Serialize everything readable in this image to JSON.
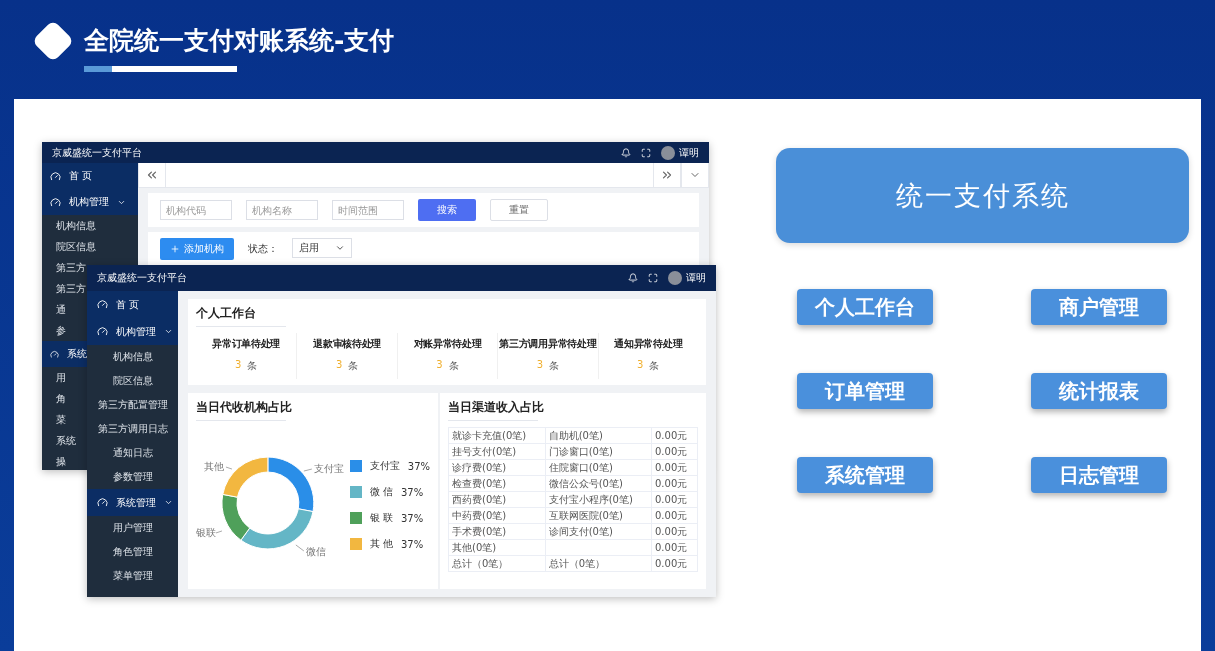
{
  "header": {
    "title": "全院统一支付对账系统-支付"
  },
  "back_window": {
    "app_title": "京威盛统一支付平台",
    "user": "谭明",
    "nav": [
      {
        "label": "首 页",
        "kind": "link"
      },
      {
        "label": "机构管理",
        "kind": "group",
        "expanded": true
      },
      {
        "label": "机构信息",
        "kind": "sub"
      },
      {
        "label": "院区信息",
        "kind": "sub"
      },
      {
        "label": "第三方",
        "kind": "sub"
      },
      {
        "label": "第三方",
        "kind": "sub"
      },
      {
        "label": "通",
        "kind": "sub"
      },
      {
        "label": "参",
        "kind": "sub"
      },
      {
        "label": "系统",
        "kind": "group"
      },
      {
        "label": "用",
        "kind": "sub"
      },
      {
        "label": "角",
        "kind": "sub"
      },
      {
        "label": "菜",
        "kind": "sub"
      },
      {
        "label": "系统",
        "kind": "sub"
      },
      {
        "label": "操",
        "kind": "sub"
      }
    ],
    "search_fields": [
      {
        "placeholder": "机构代码"
      },
      {
        "placeholder": "机构名称"
      },
      {
        "placeholder": "时间范围"
      }
    ],
    "search_button": "搜索",
    "reset_button": "重置",
    "add_button": "添加机构",
    "status_label": "状态：",
    "status_select": "启用"
  },
  "front_window": {
    "app_title": "京威盛统一支付平台",
    "user": "谭明",
    "nav": [
      {
        "label": "首 页",
        "kind": "link"
      },
      {
        "label": "机构管理",
        "kind": "group",
        "expanded": true
      },
      {
        "label": "机构信息",
        "kind": "sub"
      },
      {
        "label": "院区信息",
        "kind": "sub"
      },
      {
        "label": "第三方配置管理",
        "kind": "sub"
      },
      {
        "label": "第三方调用日志",
        "kind": "sub"
      },
      {
        "label": "通知日志",
        "kind": "sub"
      },
      {
        "label": "参数管理",
        "kind": "sub"
      },
      {
        "label": "系统管理",
        "kind": "group",
        "expanded": true
      },
      {
        "label": "用户管理",
        "kind": "sub"
      },
      {
        "label": "角色管理",
        "kind": "sub"
      },
      {
        "label": "菜单管理",
        "kind": "sub"
      }
    ],
    "workbench": {
      "title": "个人工作台",
      "stats": [
        {
          "label": "异常订单待处理",
          "count": "3",
          "unit": "条"
        },
        {
          "label": "退款审核待处理",
          "count": "3",
          "unit": "条"
        },
        {
          "label": "对账异常待处理",
          "count": "3",
          "unit": "条"
        },
        {
          "label": "第三方调用异常待处理",
          "count": "3",
          "unit": "条"
        },
        {
          "label": "通知异常待处理",
          "count": "3",
          "unit": "条"
        }
      ]
    },
    "donut_card": {
      "title": "当日代收机构占比",
      "slice_labels": [
        "支付宝",
        "微信",
        "银联",
        "其他"
      ],
      "legend": [
        {
          "name": "支付宝",
          "percent": "37%",
          "color": "#2a8ee8"
        },
        {
          "name": "微 信",
          "percent": "37%",
          "color": "#64b6c6"
        },
        {
          "name": "银 联",
          "percent": "37%",
          "color": "#4fa05a"
        },
        {
          "name": "其 他",
          "percent": "37%",
          "color": "#f2b740"
        }
      ]
    },
    "table_card": {
      "title": "当日渠道收入占比",
      "rows": [
        [
          "就诊卡充值(0笔)",
          "自助机(0笔)",
          "0.00元"
        ],
        [
          "挂号支付(0笔)",
          "门诊窗口(0笔)",
          "0.00元"
        ],
        [
          "诊疗费(0笔)",
          "住院窗口(0笔)",
          "0.00元"
        ],
        [
          "检查费(0笔)",
          "微信公众号(0笔)",
          "0.00元"
        ],
        [
          "西药费(0笔)",
          "支付宝小程序(0笔)",
          "0.00元"
        ],
        [
          "中药费(0笔)",
          "互联网医院(0笔)",
          "0.00元"
        ],
        [
          "手术费(0笔)",
          "诊间支付(0笔)",
          "0.00元"
        ],
        [
          "其他(0笔)",
          null,
          "0.00元"
        ],
        [
          "总计（0笔）",
          "总计（0笔）",
          "0.00元"
        ]
      ]
    }
  },
  "right_panel": {
    "title": "统一支付系统",
    "buttons": [
      "个人工作台",
      "商户管理",
      "订单管理",
      "统计报表",
      "系统管理",
      "日志管理"
    ]
  }
}
